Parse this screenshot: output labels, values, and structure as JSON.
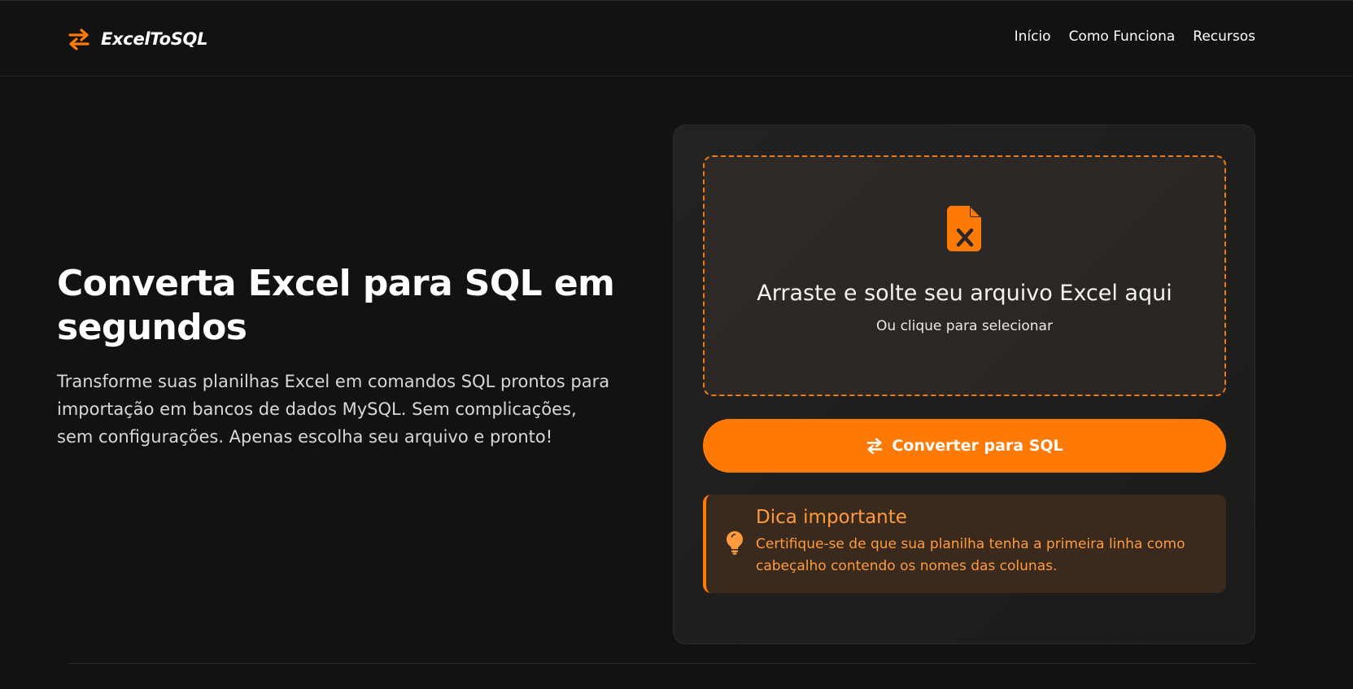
{
  "brand": {
    "name": "ExcelToSQL",
    "icon": "arrows-exchange-icon",
    "accent": "#ff7a05"
  },
  "nav": {
    "items": [
      {
        "label": "Início"
      },
      {
        "label": "Como Funciona"
      },
      {
        "label": "Recursos"
      }
    ]
  },
  "hero": {
    "title": "Converta Excel para SQL em segundos",
    "description": "Transforme suas planilhas Excel em comandos SQL prontos para importação em bancos de dados MySQL. Sem complicações, sem configurações. Apenas escolha seu arquivo e pronto!"
  },
  "upload": {
    "icon": "excel-file-icon",
    "title": "Arraste e solte seu arquivo Excel aqui",
    "subtitle": "Ou clique para selecionar"
  },
  "convert_button": {
    "label": "Converter para SQL",
    "icon": "arrows-exchange-icon"
  },
  "tip": {
    "icon": "lightbulb-icon",
    "title": "Dica importante",
    "text": "Certifique-se de que sua planilha tenha a primeira linha como cabeçalho contendo os nomes das colunas."
  }
}
